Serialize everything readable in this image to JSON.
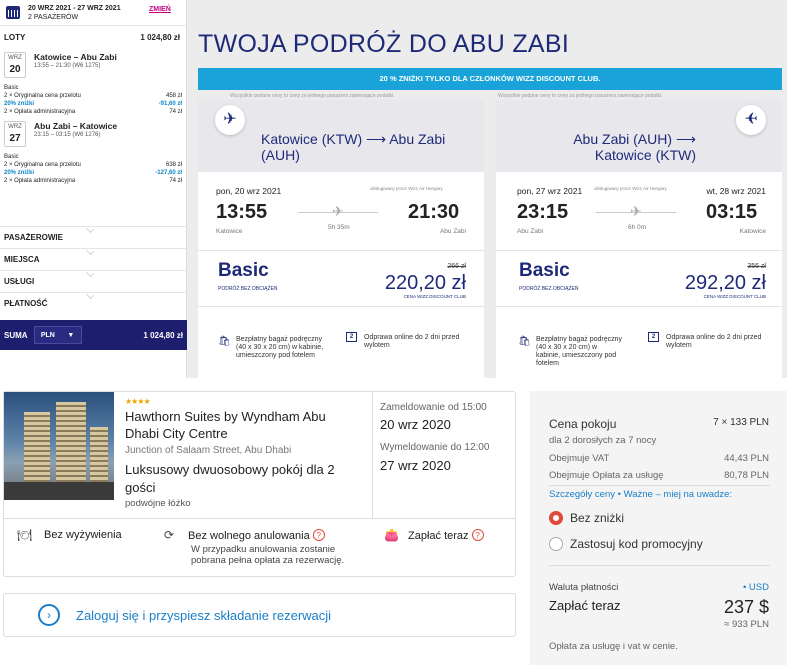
{
  "sidebar": {
    "dates_range": "20 WRZ 2021 - 27 WRZ 2021",
    "passengers": "2 PASAŻERÓW",
    "change": "ZMIEŃ",
    "flights_label": "LOTY",
    "flights_total": "1 024,80 zł",
    "outbound": {
      "month": "WRZ",
      "day": "20",
      "route": "Katowice – Abu Zabi",
      "time": "13:55 – 21:30 (W6 1275)",
      "fare": "Basic",
      "l1": "2 × Oryginalna cena przelotu",
      "v1": "458 zł",
      "l2": "20% zniżki",
      "v2": "-91,60 zł",
      "l3": "2 × Opłata administracyjna",
      "v3": "74 zł"
    },
    "inbound": {
      "month": "WRZ",
      "day": "27",
      "route": "Abu Zabi – Katowice",
      "time": "23:15 – 03:15 (W6 1276)",
      "fare": "Basic",
      "l1": "2 × Oryginalna cena przelotu",
      "v1": "638 zł",
      "l2": "20% zniżki",
      "v2": "-127,60 zł",
      "l3": "2 × Opłata administracyjna",
      "v3": "74 zł"
    },
    "nav": [
      "PASAŻEROWIE",
      "MIEJSCA",
      "USŁUGI",
      "PŁATNOŚĆ"
    ],
    "sum_label": "SUMA",
    "currency": "PLN",
    "sum_value": "1 024,80 zł"
  },
  "headline": "TWOJA PODRÓŻ DO ABU ZABI",
  "promo": "20 % ZNIŻKI TYLKO DLA CZŁONKÓW WIZZ DISCOUNT CLUB.",
  "price_note": "Wszystkie podane ceny to ceny za jednego pasażera zawierające podatki.",
  "cards": [
    {
      "route": "Katowice (KTW) ⟶ Abu Zabi (AUH)",
      "dep_date": "pon, 20 wrz 2021",
      "operator": "obsługiwany przez Wizz Air Hungary",
      "arr_date": "",
      "dep_time": "13:55",
      "arr_time": "21:30",
      "dep_city": "Katowice",
      "arr_city": "Abu Zabi",
      "duration": "5h 35m",
      "fare": "Basic",
      "fare_sub": "PODRÓŻ BEZ OBCIĄŻEŃ",
      "old_price": "266 zł",
      "price": "220,20 zł",
      "club": "CENA WIZZ DISCOUNT CLUB",
      "bag": "Bezpłatny bagaż podręczny (40 x 30 x 20 cm) w kabinie, umieszczony pod fotelem",
      "checkin": "Odprawa online do 2 dni przed wylotem"
    },
    {
      "route": "Abu Zabi (AUH) ⟶ Katowice (KTW)",
      "dep_date": "pon, 27 wrz 2021",
      "operator": "obsługiwany przez Wizz Air Hungary",
      "arr_date": "wt, 28 wrz 2021",
      "dep_time": "23:15",
      "arr_time": "03:15",
      "dep_city": "Abu Zabi",
      "arr_city": "Katowice",
      "duration": "6h 0m",
      "fare": "Basic",
      "fare_sub": "PODRÓŻ BEZ OBCIĄŻEŃ",
      "old_price": "356 zł",
      "price": "292,20 zł",
      "club": "CENA WIZZ DISCOUNT CLUB",
      "bag": "Bezpłatny bagaż podręczny (40 x 30 x 20 cm) w kabinie, umieszczony pod fotelem",
      "checkin": "Odprawa online do 2 dni przed wylotem"
    }
  ],
  "hotel": {
    "stars": "★★★★",
    "name": "Hawthorn Suites by Wyndham Abu Dhabi City Centre",
    "address": "Junction of Salaam Street, Abu Dhabi",
    "room": "Luksusowy dwuosobowy pokój dla 2 gości",
    "bed": "podwójne łóżko",
    "checkin_label": "Zameldowanie od 15:00",
    "checkin_date": "20 wrz 2020",
    "checkout_label": "Wymeldowanie do 12:00",
    "checkout_date": "27 wrz 2020",
    "meal": "Bez wyżywienia",
    "cancel": "Bez wolnego anulowania",
    "cancel_note": "W przypadku anulowania zostanie pobrana pełna opłata za rezerwację.",
    "pay": "Zapłać teraz",
    "q": "?"
  },
  "login": "Zaloguj się i przyspiesz składanie rezerwacji",
  "summary": {
    "room_price": "Cena pokoju",
    "room_price_val": "7 × 133 PLN",
    "guests": "dla 2 dorosłych  za 7 nocy",
    "vat": "Obejmuje VAT",
    "vat_val": "44,43 PLN",
    "fee": "Obejmuje Opłata za usługę",
    "fee_val": "80,78 PLN",
    "details": "Szczegóły ceny",
    "dot": "•",
    "important": "Ważne – miej na uwadze:",
    "no_discount": "Bez zniżki",
    "promo_code": "Zastosuj kod promocyjny",
    "currency_label": "Waluta płatności",
    "currency_val": "• USD",
    "pay_now": "Zapłać teraz",
    "pay_now_val": "237 $",
    "approx": "≈ 933 PLN",
    "footer": "Opłata za usługę i vat w cenie."
  }
}
